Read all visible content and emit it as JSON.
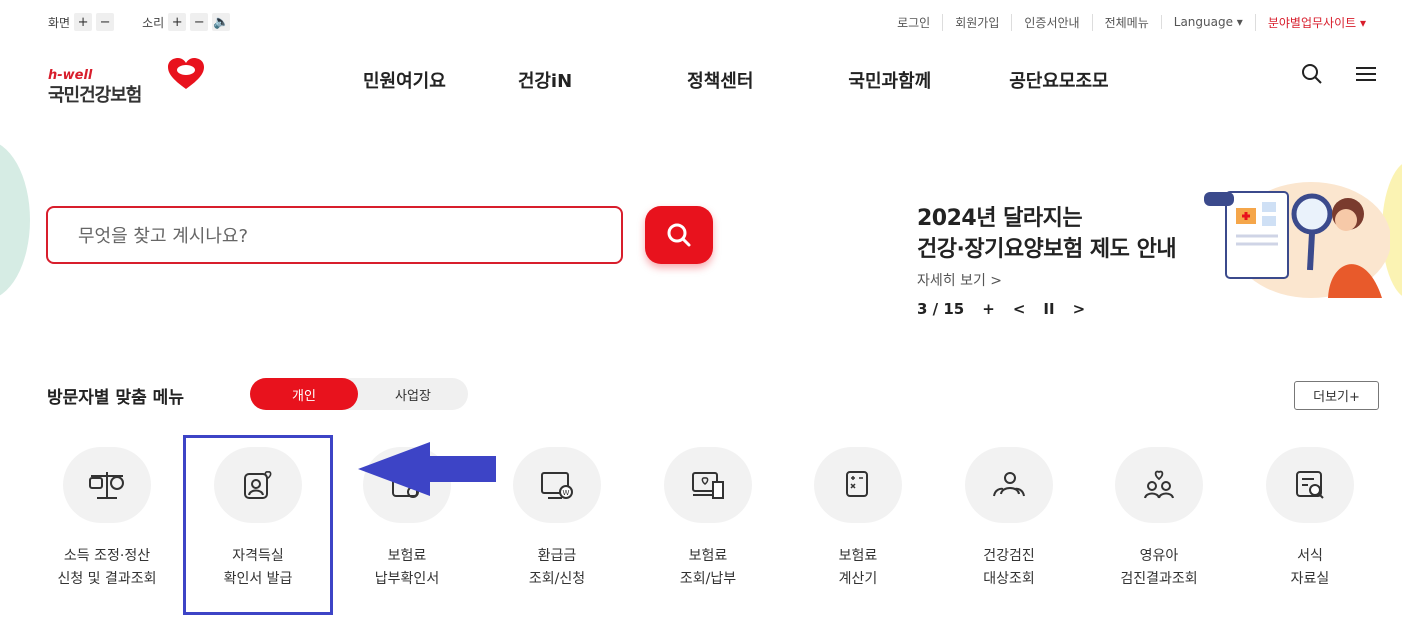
{
  "util": {
    "screen_label": "화면",
    "sound_label": "소리",
    "plus": "+",
    "minus": "−",
    "speaker": "🔈",
    "links": [
      "로그인",
      "회원가입",
      "인증서안내",
      "전체메뉴",
      "Language ▾",
      "분야별업무사이트 ▾"
    ]
  },
  "logo": {
    "tag": "h-well",
    "name": "국민건강보험"
  },
  "nav": [
    "민원여기요",
    "건강iN",
    "정책센터",
    "국민과함께",
    "공단요모조모"
  ],
  "search": {
    "placeholder": "무엇을 찾고 계시나요?"
  },
  "banner": {
    "title_line1": "2024년 달라지는",
    "title_line2": "건강·장기요양보험 제도 안내",
    "more": "자세히 보기 >",
    "page": "3 / 15",
    "plus": "+",
    "prev": "<",
    "pause": "II",
    "next": ">"
  },
  "visitor_menu": {
    "title": "방문자별 맞춤 메뉴",
    "tab_individual": "개인",
    "tab_business": "사업장",
    "more": "더보기+"
  },
  "tiles": [
    {
      "line1": "소득 조정·정산",
      "line2": "신청 및 결과조회"
    },
    {
      "line1": "자격득실",
      "line2": "확인서 발급"
    },
    {
      "line1": "보험료",
      "line2": "납부확인서"
    },
    {
      "line1": "환급금",
      "line2": "조회/신청"
    },
    {
      "line1": "보험료",
      "line2": "조회/납부"
    },
    {
      "line1": "보험료",
      "line2": "계산기"
    },
    {
      "line1": "건강검진",
      "line2": "대상조회"
    },
    {
      "line1": "영유아",
      "line2": "검진결과조회"
    },
    {
      "line1": "서식",
      "line2": "자료실"
    }
  ],
  "colors": {
    "brand_red": "#e8121d",
    "annotation_blue": "#3d44c6"
  }
}
